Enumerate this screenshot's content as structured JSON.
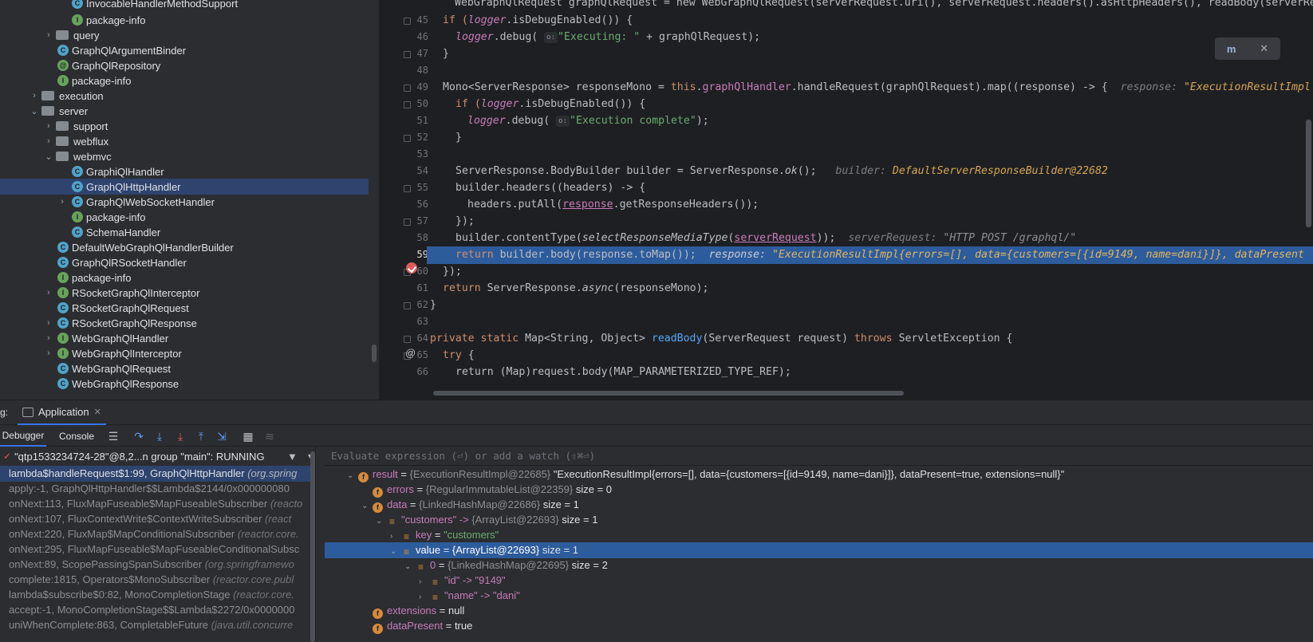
{
  "project_tree": {
    "rows": [
      {
        "label": "InvocableHandlerMethodSupport",
        "icon": "class"
      },
      {
        "label": "package-info",
        "icon": "iface"
      },
      {
        "label": "query",
        "icon": "folder"
      },
      {
        "label": "GraphQlArgumentBinder",
        "icon": "class"
      },
      {
        "label": "GraphQlRepository",
        "icon": "anno"
      },
      {
        "label": "package-info",
        "icon": "iface"
      },
      {
        "label": "execution",
        "icon": "folder"
      },
      {
        "label": "server",
        "icon": "folder"
      },
      {
        "label": "support",
        "icon": "folder"
      },
      {
        "label": "webflux",
        "icon": "folder"
      },
      {
        "label": "webmvc",
        "icon": "folder"
      },
      {
        "label": "GraphiQlHandler",
        "icon": "class"
      },
      {
        "label": "GraphQlHttpHandler",
        "icon": "class"
      },
      {
        "label": "GraphQlWebSocketHandler",
        "icon": "class"
      },
      {
        "label": "package-info",
        "icon": "iface"
      },
      {
        "label": "SchemaHandler",
        "icon": "class"
      },
      {
        "label": "DefaultWebGraphQlHandlerBuilder",
        "icon": "class"
      },
      {
        "label": "GraphQlRSocketHandler",
        "icon": "class"
      },
      {
        "label": "package-info",
        "icon": "iface"
      },
      {
        "label": "RSocketGraphQlInterceptor",
        "icon": "iface"
      },
      {
        "label": "RSocketGraphQlRequest",
        "icon": "class"
      },
      {
        "label": "RSocketGraphQlResponse",
        "icon": "class"
      },
      {
        "label": "WebGraphQlHandler",
        "icon": "iface"
      },
      {
        "label": "WebGraphQlInterceptor",
        "icon": "iface"
      },
      {
        "label": "WebGraphQlRequest",
        "icon": "class"
      },
      {
        "label": "WebGraphQlResponse",
        "icon": "class"
      }
    ]
  },
  "editor": {
    "line_numbers": [
      "45",
      "46",
      "47",
      "48",
      "49",
      "50",
      "51",
      "52",
      "53",
      "54",
      "55",
      "56",
      "57",
      "58",
      "59",
      "60",
      "61",
      "62",
      "63",
      "64",
      "65",
      "66"
    ],
    "line44": "WebGraphQlRequest graphQlRequest = new WebGraphQlRequest(serverRequest.uri(), serverRequest.headers().asHttpHeaders(), readBody(serverRe",
    "l45_a": "if (",
    "l45_b": "logger",
    "l45_c": ".isDebugEnabled()) {",
    "l46_a": "logger",
    "l46_b": ".debug(",
    "l46_badge": "o:",
    "l46_str": "\"Executing: \"",
    "l46_c": " + graphQlRequest);",
    "l47": "}",
    "l49_a": "Mono<ServerResponse> responseMono = ",
    "l49_this": "this",
    "l49_b": ".",
    "l49_field": "graphQlHandler",
    "l49_c": ".handleRequest(graphQlRequest).map((response) -> {",
    "l49_hint": "response: ",
    "l49_hintv": "\"ExecutionResultImpl",
    "l50_a": "if (",
    "l50_b": "logger",
    "l50_c": ".isDebugEnabled()) {",
    "l51_a": "logger",
    "l51_b": ".debug(",
    "l51_badge": "o:",
    "l51_str": "\"Execution complete\"",
    "l51_c": ");",
    "l52": "}",
    "l54_a": "ServerResponse.BodyBuilder builder = ServerResponse.",
    "l54_b": "ok",
    "l54_c": "();",
    "l54_hint": "builder: ",
    "l54_hintv": "DefaultServerResponseBuilder@22682",
    "l55": "builder.headers((headers) -> {",
    "l56_a": "headers.putAll(",
    "l56_b": "response",
    "l56_c": ".getResponseHeaders());",
    "l57": "});",
    "l58_a": "builder.contentType(",
    "l58_b": "selectResponseMediaType",
    "l58_c": "(",
    "l58_d": "serverRequest",
    "l58_e": "));",
    "l58_hint": "serverRequest: ",
    "l58_hintv": "\"HTTP POST /graphql/\"",
    "l59_kw": "return",
    "l59_a": " builder.body(response.toMap());",
    "l59_hint": "response: ",
    "l59_hintv": "\"ExecutionResultImpl{errors=[], data={customers=[{id=9149, name=dani}]}, dataPresent",
    "l60": "});",
    "l61_kw": "return",
    "l61_a": " ServerResponse.",
    "l61_b": "async",
    "l61_c": "(responseMono);",
    "l62": "}",
    "l64_kw": "private static",
    "l64_a": " Map<String, Object> ",
    "l64_fn": "readBody",
    "l64_b": "(ServerRequest request) ",
    "l64_kw2": "throws",
    "l64_c": " ServletException {",
    "l65_kw": "try",
    "l65_a": " {",
    "l66": "return (Map)request.body(MAP_PARAMETERIZED_TYPE_REF);",
    "maven_icon": "m-refresh-icon",
    "close_glyph": "✕"
  },
  "debug": {
    "panel_prefix": "g:",
    "tab_label": "Application",
    "debugger_tab": "Debugger",
    "console_tab": "Console",
    "thread": "\"qtp1533234724-28\"@8,2...n group \"main\": RUNNING",
    "eval_placeholder": "Evaluate expression (⏎) or add a watch (⇧⌘⏎)",
    "frames": [
      {
        "method": "lambda$handleRequest$1:99, GraphQlHttpHandler",
        "loc": "(org.spring"
      },
      {
        "method": "apply:-1, GraphQlHttpHandler$$Lambda$2144/0x000000080",
        "loc": ""
      },
      {
        "method": "onNext:113, FluxMapFuseable$MapFuseableSubscriber",
        "loc": "(reacto"
      },
      {
        "method": "onNext:107, FluxContextWrite$ContextWriteSubscriber",
        "loc": "(react"
      },
      {
        "method": "onNext:220, FluxMap$MapConditionalSubscriber",
        "loc": "(reactor.core."
      },
      {
        "method": "onNext:295, FluxMapFuseable$MapFuseableConditionalSubsc",
        "loc": ""
      },
      {
        "method": "onNext:89, ScopePassingSpanSubscriber",
        "loc": "(org.springframewo"
      },
      {
        "method": "complete:1815, Operators$MonoSubscriber",
        "loc": "(reactor.core.publ"
      },
      {
        "method": "lambda$subscribe$0:82, MonoCompletionStage",
        "loc": "(reactor.core."
      },
      {
        "method": "accept:-1, MonoCompletionStage$$Lambda$2272/0x0000000",
        "loc": ""
      },
      {
        "method": "uniWhenComplete:863, CompletableFuture",
        "loc": "(java.util.concurre"
      }
    ],
    "vars": [
      {
        "name": "result",
        "ref": "{ExecutionResultImpl@22685}",
        "value": "\"ExecutionResultImpl{errors=[], data={customers=[{id=9149, name=dani}]}, dataPresent=true, extensions=null}\"",
        "size": ""
      },
      {
        "name": "errors",
        "ref": "{RegularImmutableList@22359}",
        "value": "",
        "size": "size = 0"
      },
      {
        "name": "data",
        "ref": "{LinkedHashMap@22686}",
        "value": "",
        "size": "size = 1"
      },
      {
        "name": "\"customers\" -> ",
        "ref": "{ArrayList@22693}",
        "value": "",
        "size": "size = 1"
      },
      {
        "name": "key",
        "ref": "",
        "value": "\"customers\"",
        "size": ""
      },
      {
        "name": "value",
        "ref": "{ArrayList@22693}",
        "value": "",
        "size": "size = 1"
      },
      {
        "name": "0",
        "ref": "{LinkedHashMap@22695}",
        "value": "",
        "size": "size = 2"
      },
      {
        "name": "\"id\" -> \"9149\"",
        "ref": "",
        "value": "",
        "size": ""
      },
      {
        "name": "\"name\" -> \"dani\"",
        "ref": "",
        "value": "",
        "size": ""
      },
      {
        "name": "extensions",
        "ref": "",
        "value": "null",
        "size": ""
      },
      {
        "name": "dataPresent",
        "ref": "",
        "value": "true",
        "size": ""
      }
    ],
    "eq": " = "
  }
}
